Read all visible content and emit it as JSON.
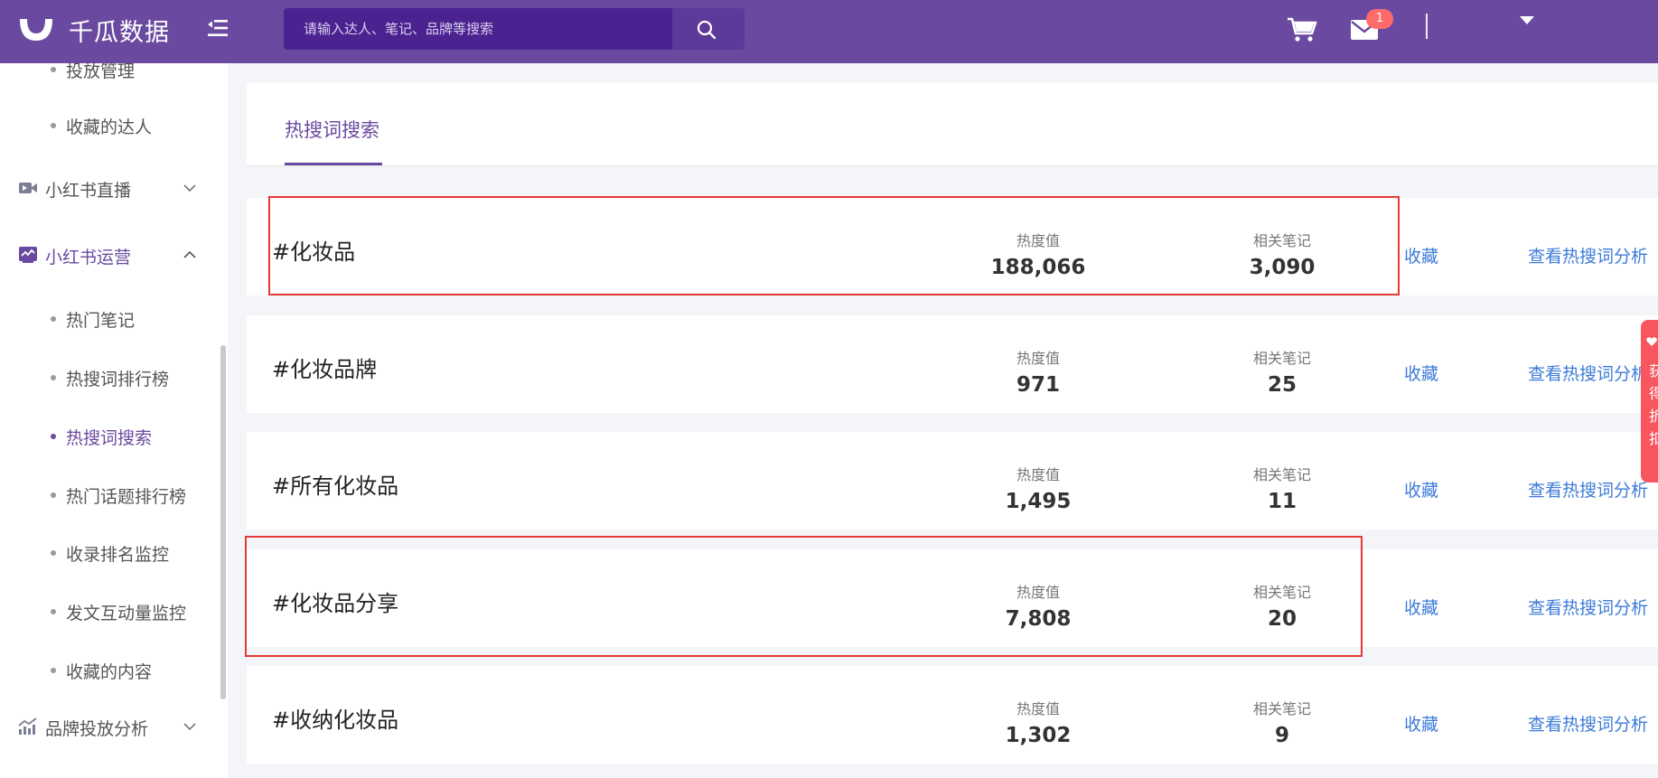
{
  "brand": {
    "name": "千瓜数据",
    "accent": "#6a4aa0",
    "link": "#3d7bd9",
    "highlight": "#e53935"
  },
  "header": {
    "search_placeholder": "请输入达人、笔记、品牌等搜索",
    "search_icon": "search-icon",
    "cart_icon": "cart-icon",
    "mail_icon": "mail-icon",
    "mail_badge": "1"
  },
  "sidebar": {
    "items_top": [
      {
        "label": "投放管理"
      },
      {
        "label": "收藏的达人"
      }
    ],
    "groups": [
      {
        "label": "小红书直播",
        "icon": "video-icon",
        "open": false
      },
      {
        "label": "小红书运营",
        "icon": "operations-icon",
        "open": true
      },
      {
        "label": "品牌投放分析",
        "icon": "trend-chart-icon",
        "open": false
      }
    ],
    "ops_items": [
      {
        "label": "热门笔记"
      },
      {
        "label": "热搜词排行榜"
      },
      {
        "label": "热搜词搜索",
        "active": true
      },
      {
        "label": "热门话题排行榜"
      },
      {
        "label": "收录排名监控"
      },
      {
        "label": "发文互动量监控"
      },
      {
        "label": "收藏的内容"
      }
    ]
  },
  "main": {
    "tab_label": "热搜词搜索",
    "heat_label": "热度值",
    "notes_label": "相关笔记",
    "fav_label": "收藏",
    "analyze_label": "查看热搜词分析",
    "results": [
      {
        "keyword": "#化妆品",
        "heat": "188,066",
        "notes": "3,090",
        "highlighted": true
      },
      {
        "keyword": "#化妆品牌",
        "heat": "971",
        "notes": "25",
        "highlighted": false
      },
      {
        "keyword": "#所有化妆品",
        "heat": "1,495",
        "notes": "11",
        "highlighted": false
      },
      {
        "keyword": "#化妆品分享",
        "heat": "7,808",
        "notes": "20",
        "highlighted": true
      },
      {
        "keyword": "#收纳化妆品",
        "heat": "1,302",
        "notes": "9",
        "highlighted": false
      }
    ]
  },
  "float_tab": {
    "text": "获得折扣"
  }
}
